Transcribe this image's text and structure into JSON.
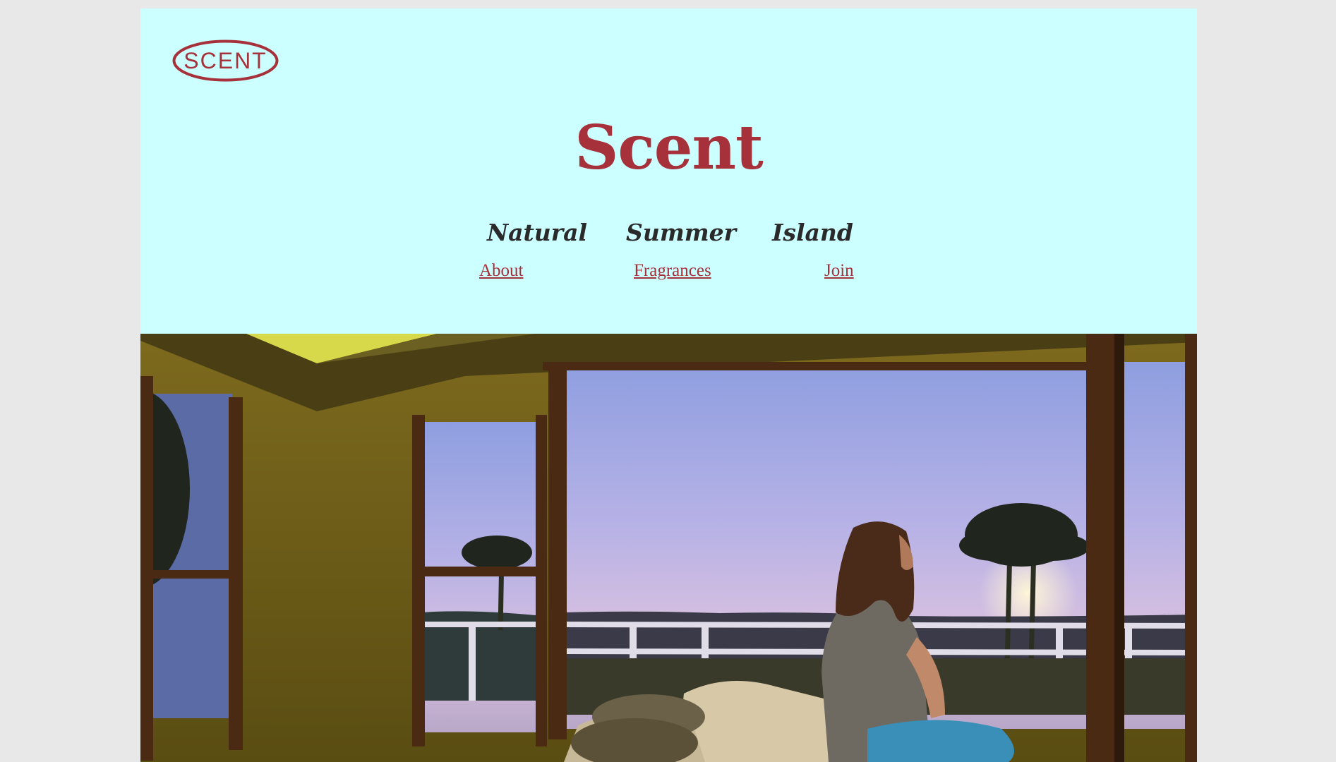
{
  "brand": {
    "logo_text": "SCENT",
    "title": "Scent",
    "accent_color": "#a6313a",
    "header_background": "#ccffff"
  },
  "taglines": [
    "Natural",
    "Summer",
    "Island"
  ],
  "nav": {
    "about": "About",
    "fragrances": "Fragrances",
    "join": "Join"
  },
  "hero": {
    "subject": "woman sitting on a bed looking out large windows at palm trees and a sunset sky"
  }
}
